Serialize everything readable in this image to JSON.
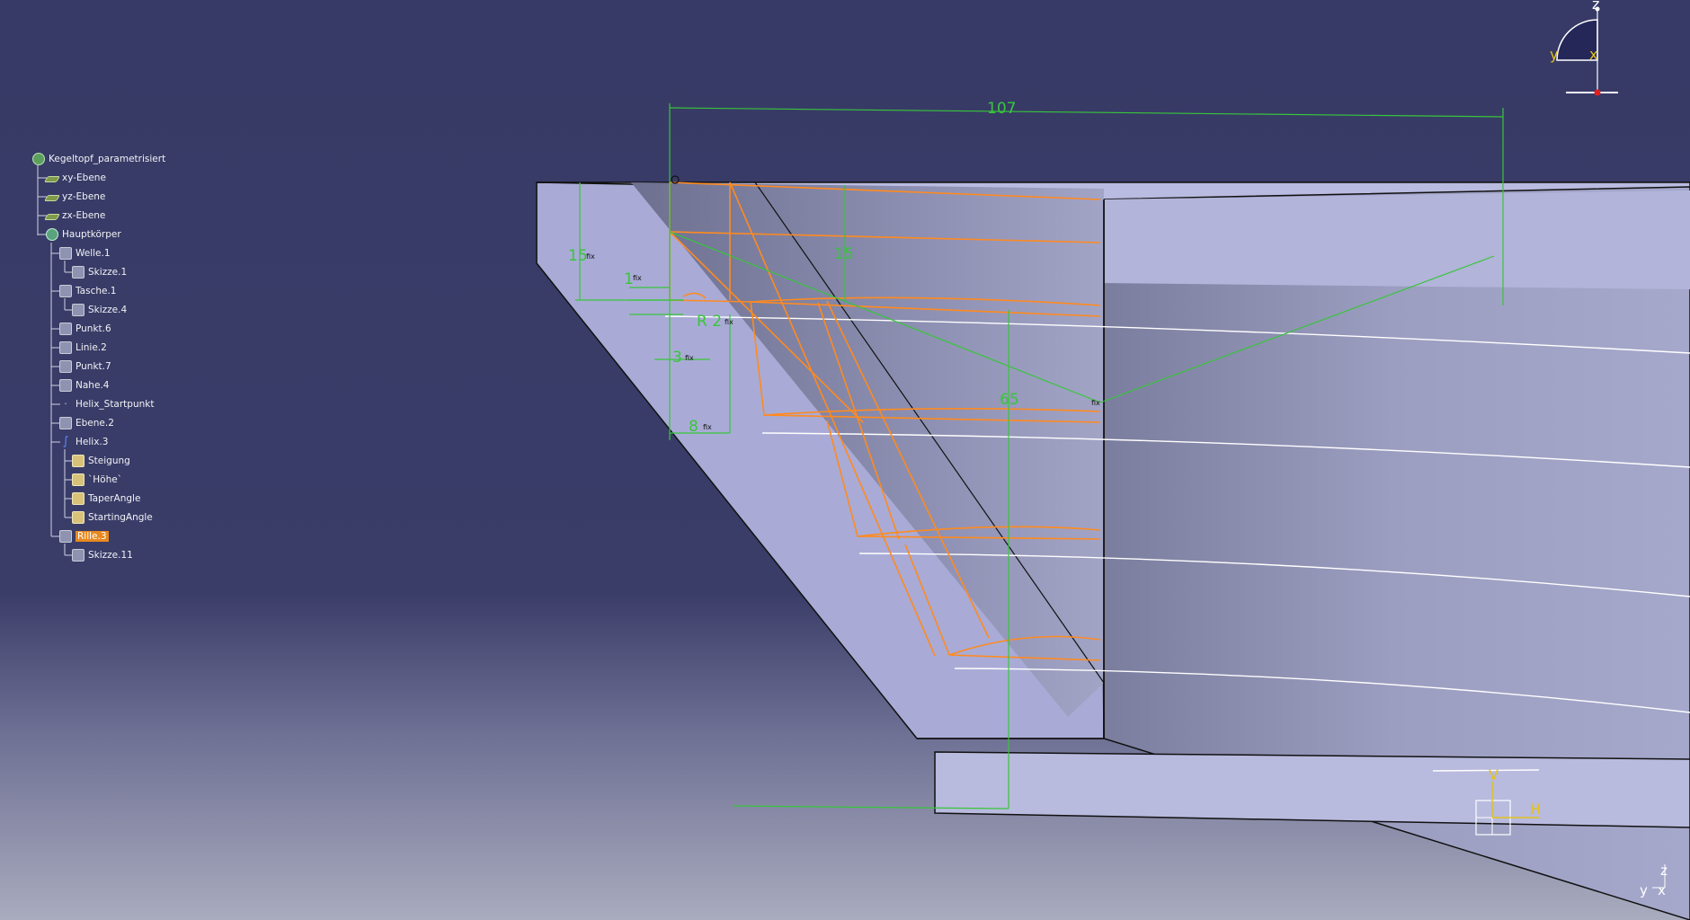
{
  "tree": {
    "items": [
      {
        "label": "Kegeltopf_parametrisiert",
        "icon": "part-gear-icon",
        "selected": false
      },
      {
        "label": "xy-Ebene",
        "icon": "plane-icon",
        "selected": false
      },
      {
        "label": "yz-Ebene",
        "icon": "plane-icon",
        "selected": false
      },
      {
        "label": "zx-Ebene",
        "icon": "plane-icon",
        "selected": false
      },
      {
        "label": "Hauptkörper",
        "icon": "body-icon",
        "selected": false
      },
      {
        "label": "Welle.1",
        "icon": "shaft-icon",
        "selected": false
      },
      {
        "label": "Skizze.1",
        "icon": "sketch-icon",
        "selected": false
      },
      {
        "label": "Tasche.1",
        "icon": "pocket-icon",
        "selected": false
      },
      {
        "label": "Skizze.4",
        "icon": "sketch-icon",
        "selected": false
      },
      {
        "label": "Punkt.6",
        "icon": "point-icon",
        "selected": false
      },
      {
        "label": "Linie.2",
        "icon": "line-icon",
        "selected": false
      },
      {
        "label": "Punkt.7",
        "icon": "point-icon",
        "selected": false
      },
      {
        "label": "Nahe.4",
        "icon": "near-icon",
        "selected": false
      },
      {
        "label": "Helix_Startpunkt",
        "icon": "point-icon",
        "selected": false
      },
      {
        "label": "Ebene.2",
        "icon": "plane-icon",
        "selected": false
      },
      {
        "label": "Helix.3",
        "icon": "helix-icon",
        "selected": false
      },
      {
        "label": "Steigung",
        "icon": "parameter-icon",
        "selected": false
      },
      {
        "label": "`Höhe`",
        "icon": "parameter-icon",
        "selected": false
      },
      {
        "label": "TaperAngle",
        "icon": "parameter-icon",
        "selected": false
      },
      {
        "label": "StartingAngle",
        "icon": "parameter-icon",
        "selected": false
      },
      {
        "label": "Rille.3",
        "icon": "groove-icon",
        "selected": true
      },
      {
        "label": "Skizze.11",
        "icon": "sketch-icon",
        "selected": false
      }
    ]
  },
  "dimensions": {
    "width_label": "107",
    "left_height": "15",
    "inner_height": "15",
    "thickness": "1",
    "radius": "R 2",
    "offset_small": "3",
    "offset_width": "8",
    "depth": "65"
  },
  "compass": {
    "z": "z",
    "y": "y",
    "x": "x"
  },
  "sketch_axes": {
    "v": "V",
    "h": "H"
  },
  "corner_axes": {
    "z": "z",
    "y": "y",
    "x": "x"
  },
  "colors": {
    "background_top": "#373a66",
    "part_face": "#a9abd6",
    "dimension": "#37c63a",
    "profile": "#ff8a1f",
    "selection": "#e8891f"
  }
}
